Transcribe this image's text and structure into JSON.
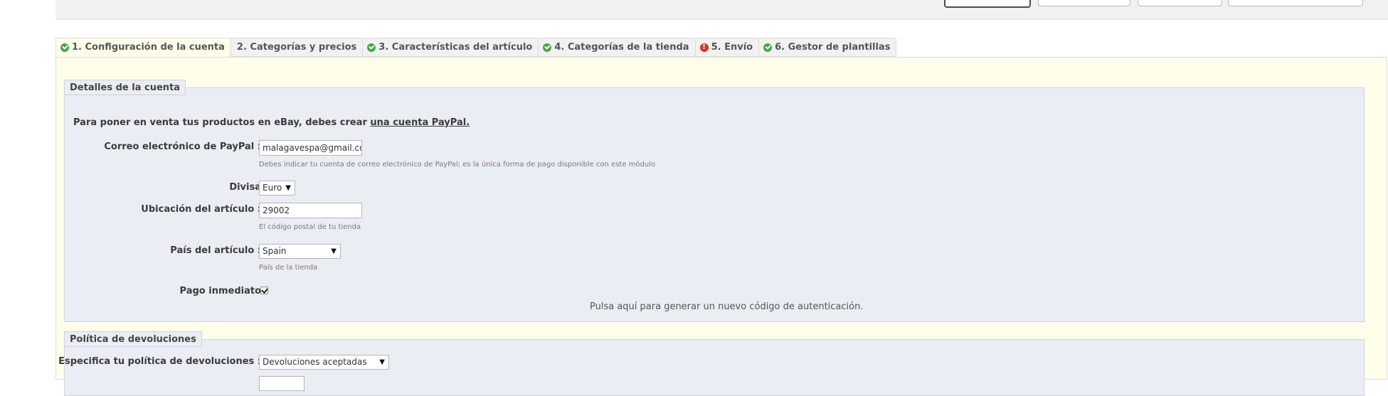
{
  "tabs": [
    {
      "label": "1. Configuración de la cuenta",
      "status": "ok",
      "active": true
    },
    {
      "label": "2. Categorías y precios",
      "status": "none",
      "active": false
    },
    {
      "label": "3. Características del artículo",
      "status": "ok",
      "active": false
    },
    {
      "label": "4. Categorías de la tienda",
      "status": "ok",
      "active": false
    },
    {
      "label": "5. Envío",
      "status": "error",
      "active": false
    },
    {
      "label": "6. Gestor de plantillas",
      "status": "ok",
      "active": false
    }
  ],
  "account": {
    "legend": "Detalles de la cuenta",
    "intro_text": "Para poner en venta tus productos en eBay, debes crear ",
    "intro_link": "una cuenta PayPal.",
    "paypal_label": "Correo electrónico de PayPal :",
    "paypal_value": "malagavespa@gmail.com",
    "paypal_hint": "Debes indicar tu cuenta de correo electrónico de PayPal; es la única forma de pago disponible con este módulo",
    "currency_label": "Divisa",
    "currency_value": "Euro",
    "location_label": "Ubicación del artículo :",
    "location_value": "29002",
    "location_hint": "El código postal de tu tienda",
    "country_label": "País del artículo :",
    "country_value": "Spain",
    "country_hint": "País de la tienda",
    "immediate_payment_label": "Pago inmediato",
    "immediate_payment_checked": true,
    "auth_link": "Pulsa aquí para generar un nuevo código de autenticación."
  },
  "returns": {
    "legend": "Política de devoluciones",
    "policy_label": "Especifica tu política de devoluciones :",
    "policy_value": "Devoluciones aceptadas"
  },
  "colors": {
    "tab_ok": "#46a546",
    "tab_error": "#d9312b",
    "panel_bg": "#fffeea",
    "fieldset_bg": "#ebedf4"
  }
}
